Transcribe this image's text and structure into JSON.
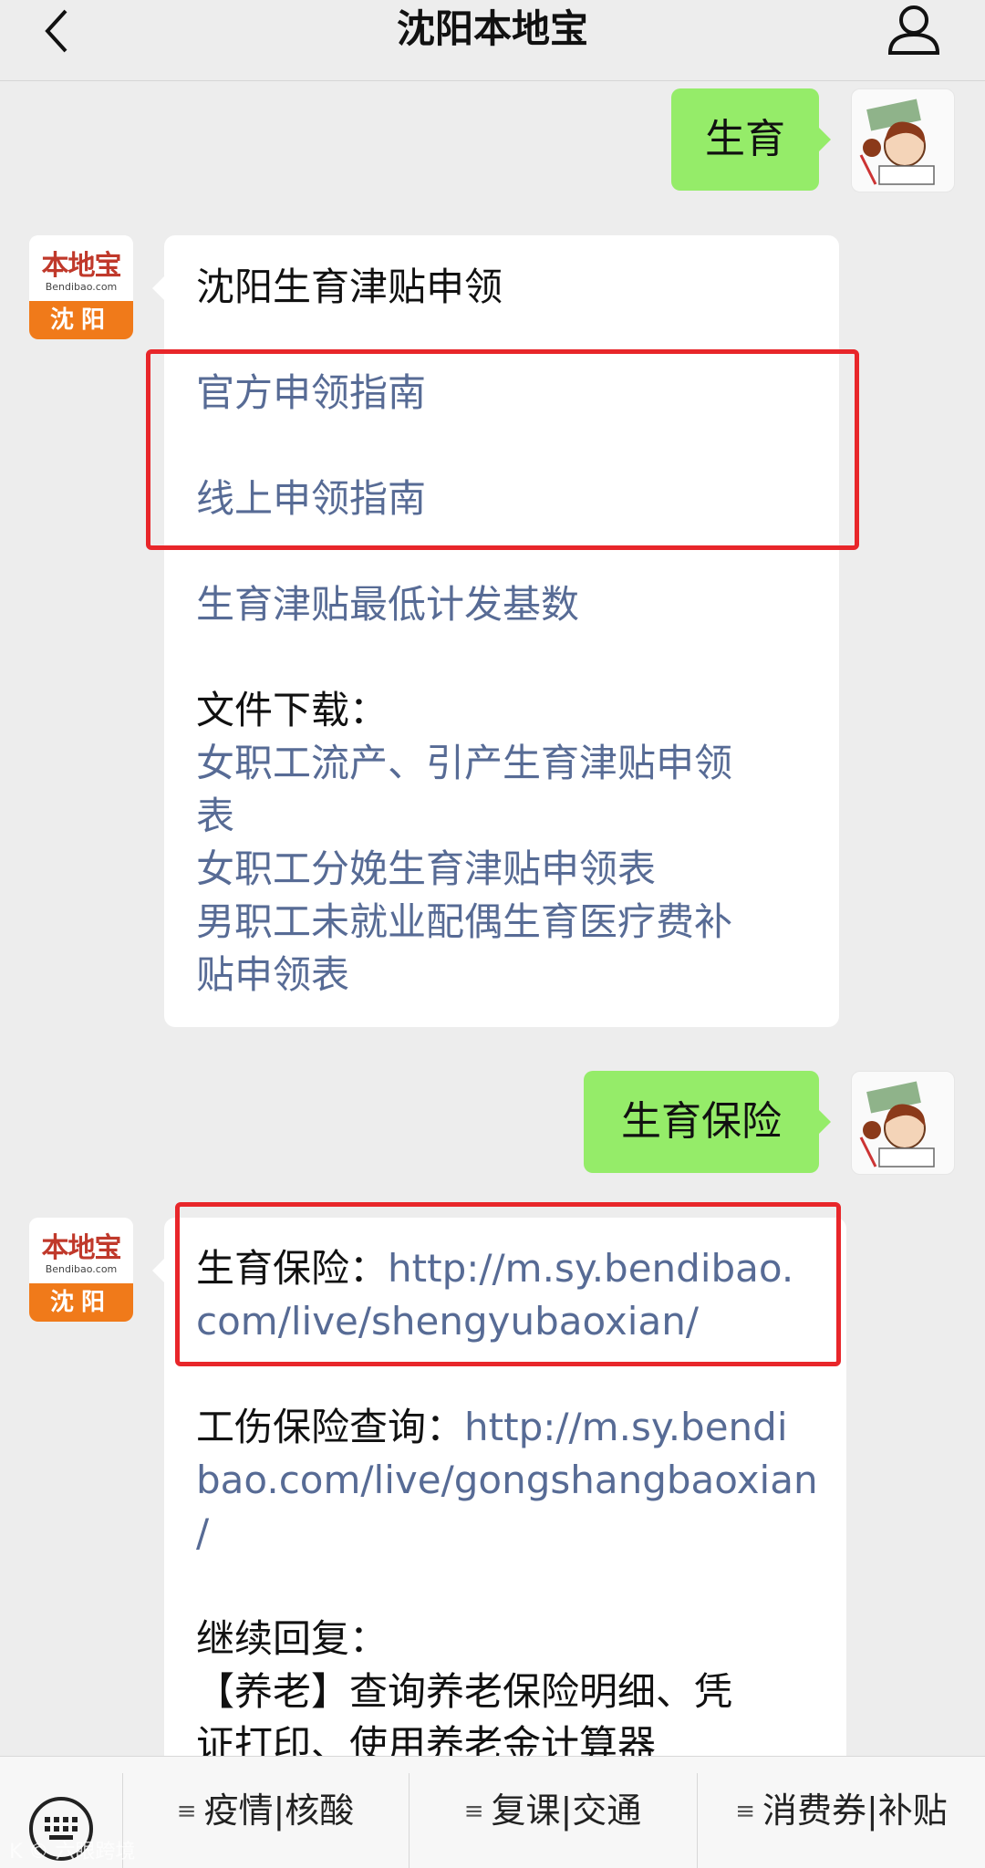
{
  "header": {
    "title": "沈阳本地宝"
  },
  "bot": {
    "logo_main": "本地宝",
    "logo_sub": "Bendibao.com",
    "logo_city": "沈阳"
  },
  "chat": {
    "msg1_user": "生育",
    "msg2": {
      "title": "沈阳生育津贴申领",
      "link1": "官方申领指南",
      "link2": "线上申领指南",
      "link3": "生育津贴最低计发基数",
      "downloads_label": "文件下载：",
      "dl1_line1": "女职工流产、引产生育津贴申领",
      "dl1_line2": "表",
      "dl2": "女职工分娩生育津贴申领表",
      "dl3_line1": "男职工未就业配偶生育医疗费补",
      "dl3_line2": "贴申领表"
    },
    "msg3_user": "生育保险",
    "msg4": {
      "label1": "生育保险：",
      "url1_line1": "http://m.sy.bendibao.",
      "url1_line2": "com/live/shengyubaoxian/",
      "label2": "工伤保险查询：",
      "url2_line1": "http://m.sy.bendi",
      "url2_line2": "bao.com/live/gongshangbaoxian",
      "url2_line3": "/",
      "continue_label": "继续回复：",
      "pension_line1": "【养老】查询养老保险明细、凭",
      "pension_line2": "证打印、使用养老金计算器"
    }
  },
  "menu": {
    "items": [
      "疫情|核酸",
      "复课|交通",
      "消费券|补贴"
    ]
  },
  "watermark": "K © 六眼跨境"
}
